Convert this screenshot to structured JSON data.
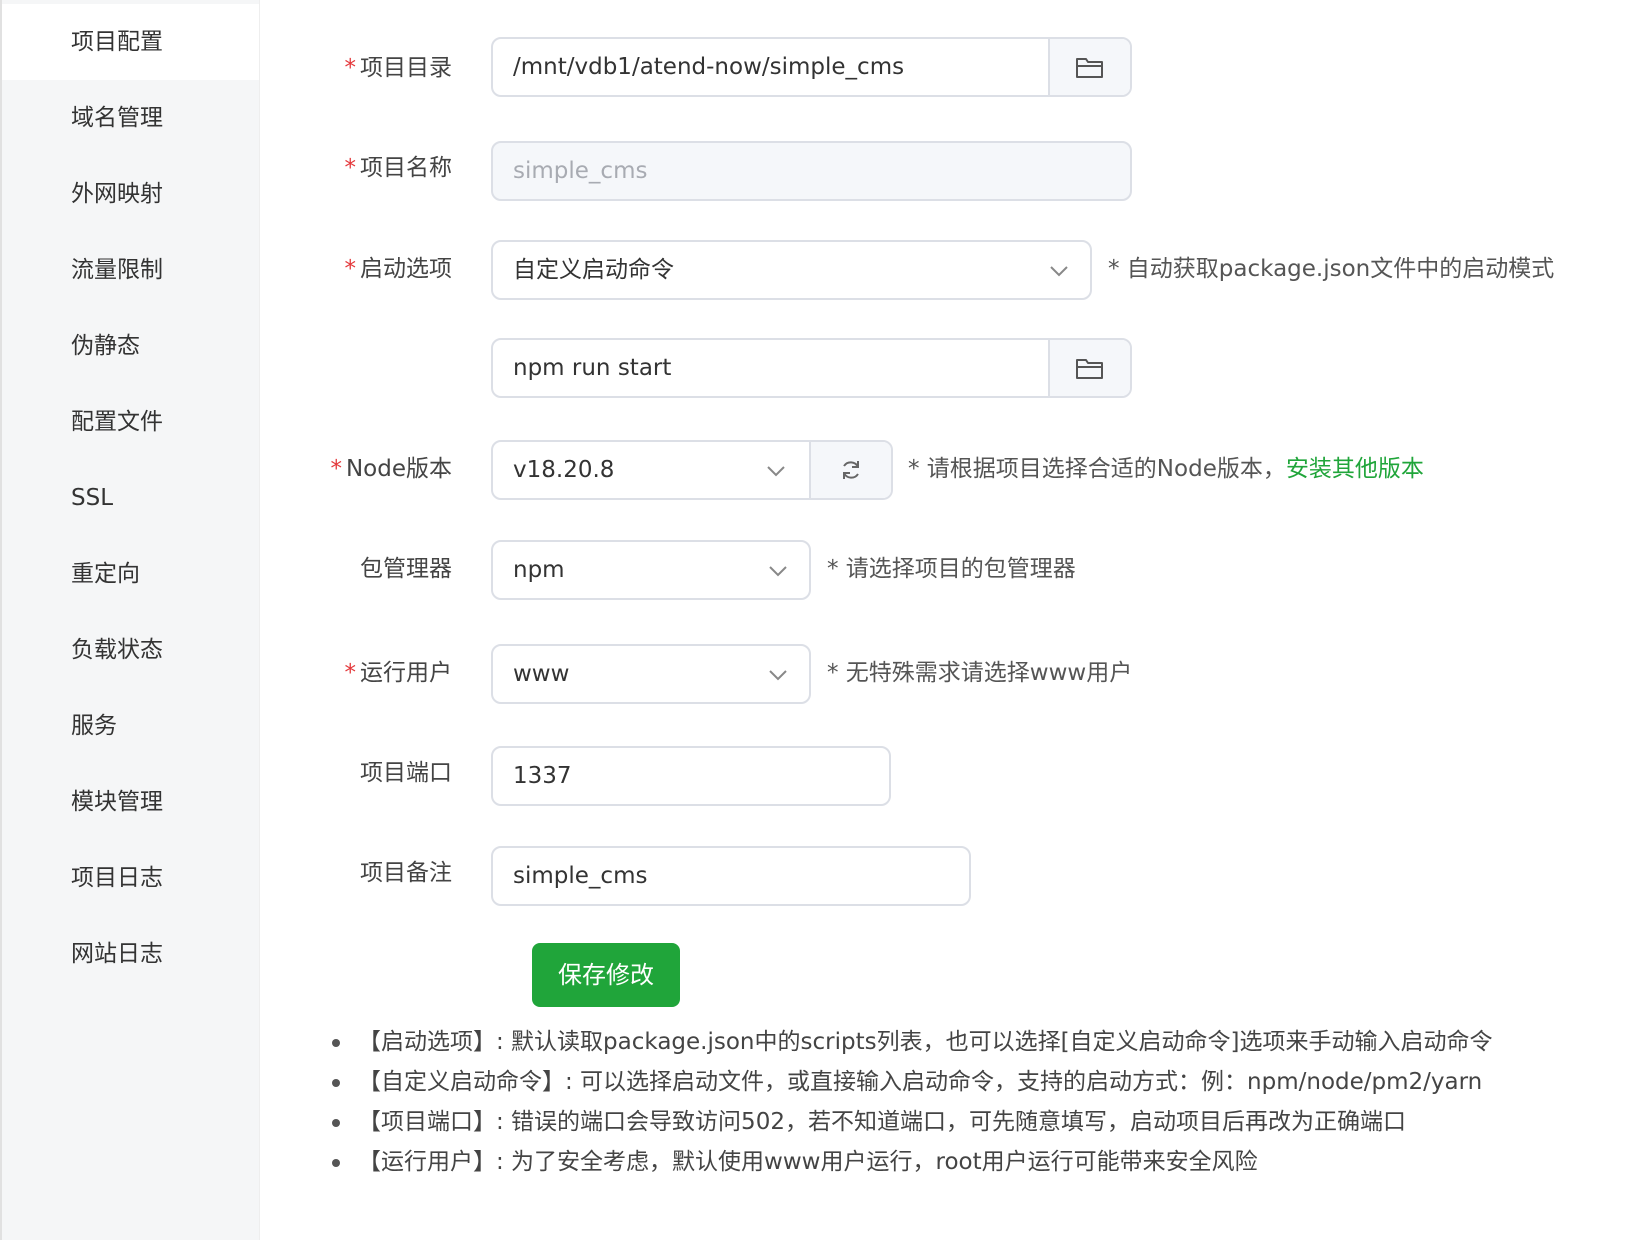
{
  "sidebar": {
    "items": [
      {
        "label": "项目配置"
      },
      {
        "label": "域名管理"
      },
      {
        "label": "外网映射"
      },
      {
        "label": "流量限制"
      },
      {
        "label": "伪静态"
      },
      {
        "label": "配置文件"
      },
      {
        "label": "SSL"
      },
      {
        "label": "重定向"
      },
      {
        "label": "负载状态"
      },
      {
        "label": "服务"
      },
      {
        "label": "模块管理"
      },
      {
        "label": "项目日志"
      },
      {
        "label": "网站日志"
      }
    ],
    "active_index": 0
  },
  "form": {
    "required_mark": "*",
    "project_dir": {
      "label": "项目目录",
      "value": "/mnt/vdb1/atend-now/simple_cms",
      "icon": "folder-icon"
    },
    "project_name": {
      "label": "项目名称",
      "value": "simple_cms"
    },
    "start_option": {
      "label": "启动选项",
      "value": "自定义启动命令",
      "hint": "* 自动获取package.json文件中的启动模式"
    },
    "start_command": {
      "value": "npm run start",
      "icon": "folder-icon"
    },
    "node_version": {
      "label": "Node版本",
      "value": "v18.20.8",
      "icon": "refresh-icon",
      "hint": "* 请根据项目选择合适的Node版本，",
      "hint_link": "安装其他版本"
    },
    "package_manager": {
      "label": "包管理器",
      "value": "npm",
      "hint": "* 请选择项目的包管理器"
    },
    "run_user": {
      "label": "运行用户",
      "value": "www",
      "hint": "* 无特殊需求请选择www用户"
    },
    "port": {
      "label": "项目端口",
      "value": "1337"
    },
    "remark": {
      "label": "项目备注",
      "value": "simple_cms"
    },
    "save_label": "保存修改"
  },
  "notes": [
    "【启动选项】: 默认读取package.json中的scripts列表，也可以选择[自定义启动命令]选项来手动输入启动命令",
    "【自定义启动命令】: 可以选择启动文件，或直接输入启动命令，支持的启动方式：例：npm/node/pm2/yarn",
    "【项目端口】: 错误的端口会导致访问502，若不知道端口，可先随意填写，启动项目后再改为正确端口",
    "【运行用户】: 为了安全考虑，默认使用www用户运行，root用户运行可能带来安全风险"
  ],
  "colors": {
    "accent": "#20a53a",
    "required": "#e4393c"
  }
}
